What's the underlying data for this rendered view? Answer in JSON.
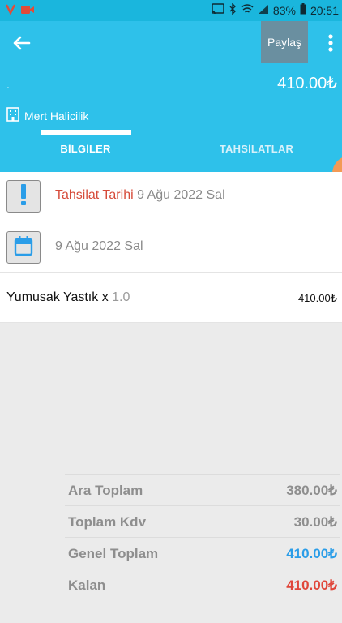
{
  "status": {
    "battery": "83%",
    "time": "20:51"
  },
  "header": {
    "share_label": "Paylaş",
    "dot": ".",
    "amount": "410.00₺",
    "company": "Mert Halicilik"
  },
  "tabs": [
    {
      "label": "BİLGİLER"
    },
    {
      "label": "TAHSİLATLAR"
    }
  ],
  "info": {
    "collection_label": "Tahsilat Tarihi",
    "collection_date": "9 Ağu 2022 Sal",
    "date": "9 Ağu 2022 Sal"
  },
  "items": [
    {
      "name": "Yumusak Yastık x",
      "qty": "1.0",
      "price": "410.00₺"
    }
  ],
  "totals": [
    {
      "label": "Ara Toplam",
      "value": "380.00₺"
    },
    {
      "label": "Toplam Kdv",
      "value": "30.00₺"
    },
    {
      "label": "Genel Toplam",
      "value": "410.00₺"
    },
    {
      "label": "Kalan",
      "value": "410.00₺"
    }
  ],
  "colors": {
    "primary": "#2ec1ea",
    "status_bar": "#1ab6dd",
    "accent_red": "#d64b3a",
    "total_blue": "#2a9de8",
    "remaining_red": "#e0463a",
    "fab_orange": "#f39a55"
  }
}
